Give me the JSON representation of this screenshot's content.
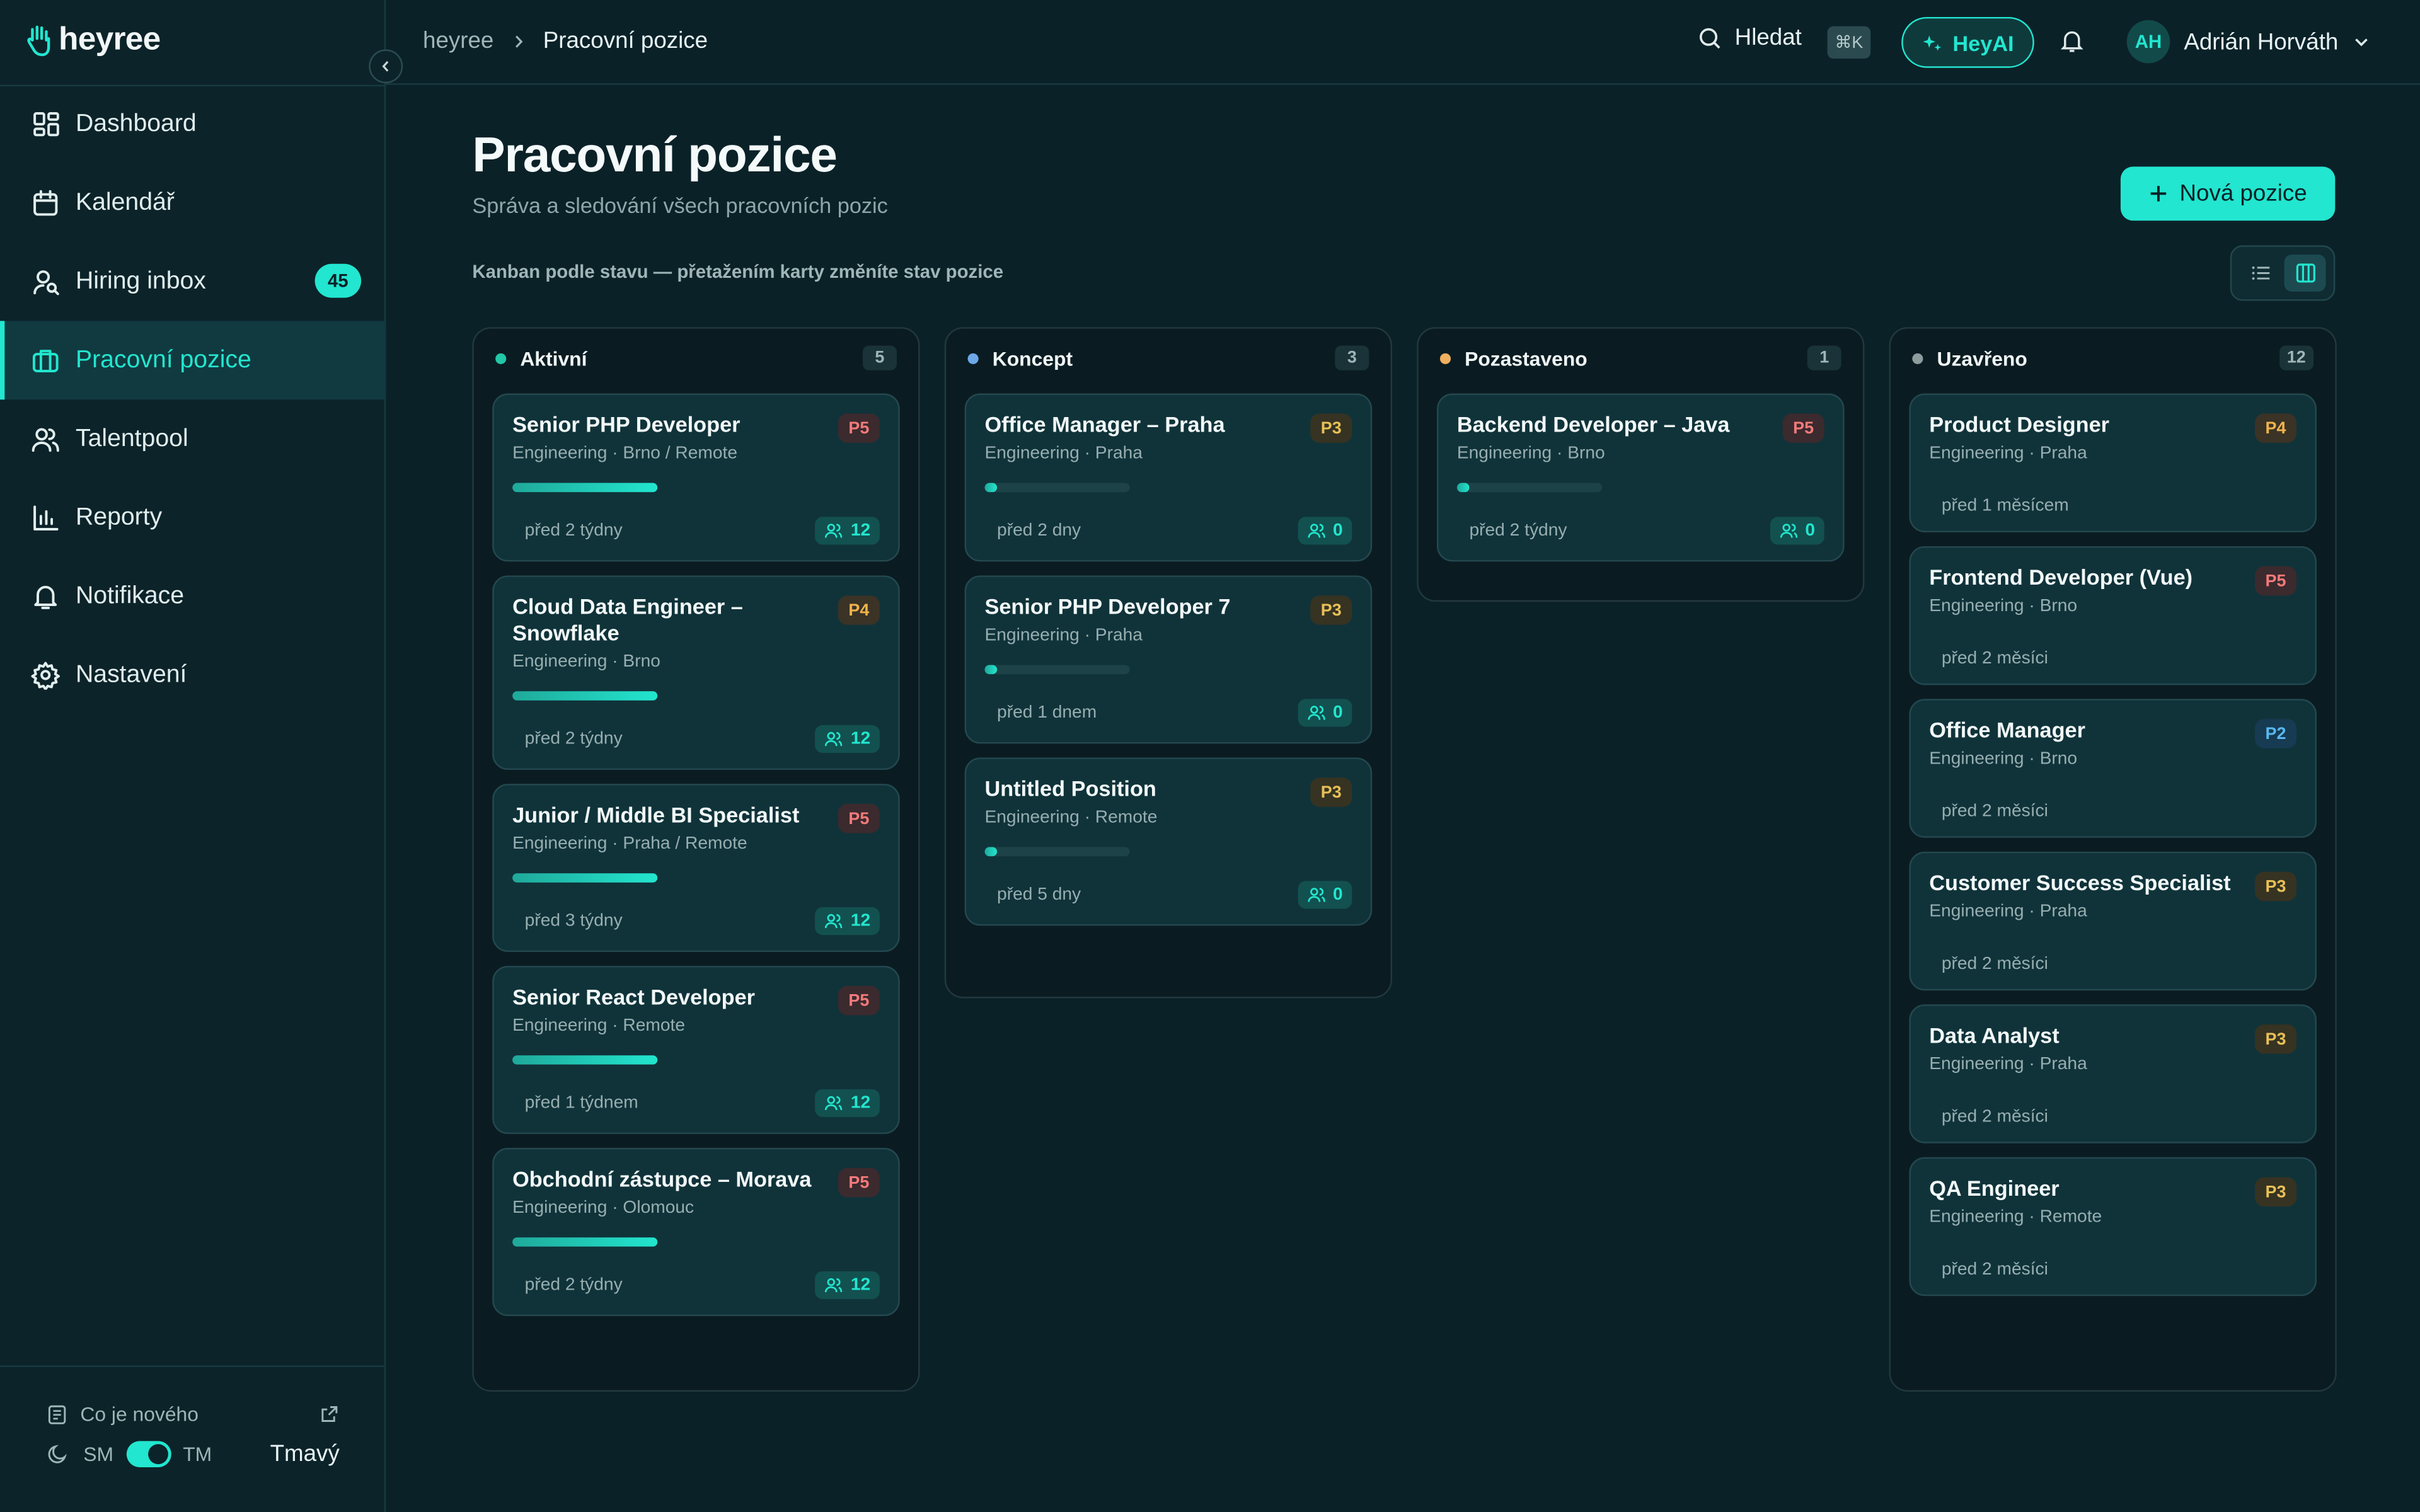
{
  "brand": {
    "name": "heyree"
  },
  "sidebar": {
    "items": [
      {
        "label": "Dashboard",
        "icon": "dashboard-icon"
      },
      {
        "label": "Kalendář",
        "icon": "calendar-icon"
      },
      {
        "label": "Hiring inbox",
        "icon": "user-search-icon",
        "badge": "45"
      },
      {
        "label": "Pracovní pozice",
        "icon": "briefcase-icon",
        "active": true
      },
      {
        "label": "Talentpool",
        "icon": "users-icon"
      },
      {
        "label": "Reporty",
        "icon": "chart-icon"
      },
      {
        "label": "Notifikace",
        "icon": "bell-icon"
      },
      {
        "label": "Nastavení",
        "icon": "gear-icon"
      }
    ],
    "whats_new": "Co je nového",
    "theme": {
      "short_light": "SM",
      "short_dark": "TM",
      "current": "Tmavý"
    }
  },
  "topbar": {
    "breadcrumb": {
      "root": "heyree",
      "current": "Pracovní pozice"
    },
    "search_label": "Hledat",
    "search_shortcut": "⌘K",
    "ai_button": "HeyAI",
    "user": {
      "initials": "AH",
      "name": "Adrián Horváth"
    }
  },
  "page": {
    "title": "Pracovní pozice",
    "subtitle": "Správa a sledování všech pracovních pozic",
    "new_button": "Nová pozice",
    "kanban_hint": "Kanban podle stavu — přetažením karty změníte stav pozice"
  },
  "colors": {
    "accent": "#22e6cf",
    "status_active": "#22c7a8",
    "status_draft": "#6ea8e8",
    "status_paused": "#f0b060",
    "status_closed": "#8e9c9e"
  },
  "columns": [
    {
      "name": "Aktivní",
      "count": "5",
      "dot": "#22c7a8",
      "cards": [
        {
          "title": "Senior PHP Developer",
          "meta": "Engineering · Brno / Remote",
          "priority": "P5",
          "progress": 1.0,
          "date": "před 2 týdny",
          "candidates": "12"
        },
        {
          "title": "Cloud Data Engineer – Snowflake",
          "meta": "Engineering · Brno",
          "priority": "P4",
          "progress": 1.0,
          "date": "před 2 týdny",
          "candidates": "12"
        },
        {
          "title": "Junior / Middle BI Specialist",
          "meta": "Engineering · Praha / Remote",
          "priority": "P5",
          "progress": 1.0,
          "date": "před 3 týdny",
          "candidates": "12"
        },
        {
          "title": "Senior React Developer",
          "meta": "Engineering · Remote",
          "priority": "P5",
          "progress": 1.0,
          "date": "před 1 týdnem",
          "candidates": "12"
        },
        {
          "title": "Obchodní zástupce – Morava",
          "meta": "Engineering · Olomouc",
          "priority": "P5",
          "progress": 1.0,
          "date": "před 2 týdny",
          "candidates": "12"
        }
      ]
    },
    {
      "name": "Koncept",
      "count": "3",
      "dot": "#6ea8e8",
      "cards": [
        {
          "title": "Office Manager – Praha",
          "meta": "Engineering · Praha",
          "priority": "P3",
          "progress": 0.08,
          "date": "před 2 dny",
          "candidates": "0"
        },
        {
          "title": "Senior PHP Developer 7",
          "meta": "Engineering · Praha",
          "priority": "P3",
          "progress": 0.08,
          "date": "před 1 dnem",
          "candidates": "0"
        },
        {
          "title": "Untitled Position",
          "meta": "Engineering · Remote",
          "priority": "P3",
          "progress": 0.08,
          "date": "před 5 dny",
          "candidates": "0"
        }
      ]
    },
    {
      "name": "Pozastaveno",
      "count": "1",
      "dot": "#f0b060",
      "cards": [
        {
          "title": "Backend Developer – Java",
          "meta": "Engineering · Brno",
          "priority": "P5",
          "progress": 0.08,
          "date": "před 2 týdny",
          "candidates": "0"
        }
      ]
    },
    {
      "name": "Uzavřeno",
      "count": "12",
      "dot": "#8e9c9e",
      "cards": [
        {
          "title": "Product Designer",
          "meta": "Engineering · Praha",
          "priority": "P4",
          "date": "před 1 měsícem"
        },
        {
          "title": "Frontend Developer (Vue)",
          "meta": "Engineering · Brno",
          "priority": "P5",
          "date": "před 2 měsíci"
        },
        {
          "title": "Office Manager",
          "meta": "Engineering · Brno",
          "priority": "P2",
          "date": "před 2 měsíci"
        },
        {
          "title": "Customer Success Specialist",
          "meta": "Engineering · Praha",
          "priority": "P3",
          "date": "před 2 měsíci"
        },
        {
          "title": "Data Analyst",
          "meta": "Engineering · Praha",
          "priority": "P3",
          "date": "před 2 měsíci"
        },
        {
          "title": "QA Engineer",
          "meta": "Engineering · Remote",
          "priority": "P3",
          "date": "před 2 měsíci"
        }
      ]
    }
  ]
}
